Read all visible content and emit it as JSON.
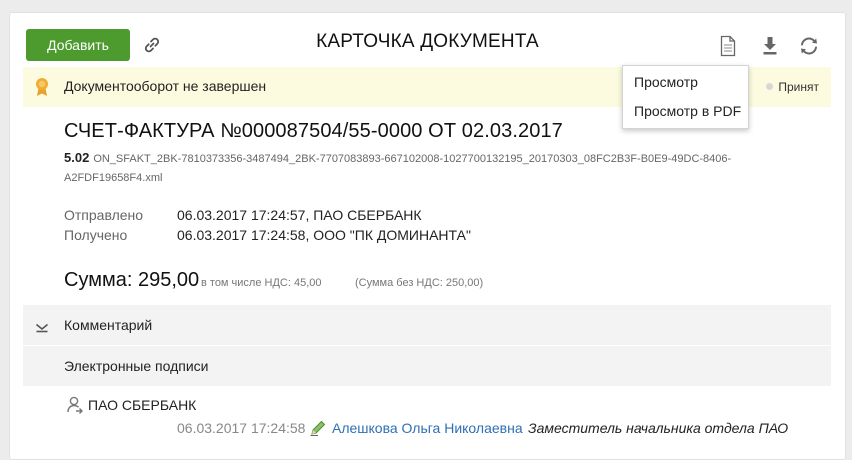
{
  "header": {
    "add_label": "Добавить",
    "title": "КАРТОЧКА ДОКУМЕНТА",
    "icons": [
      "link-icon",
      "document-icon",
      "download-icon",
      "refresh-icon"
    ]
  },
  "status": {
    "text": "Документооборот не завершен",
    "badge": "Принят"
  },
  "dropdown": {
    "items": [
      "Просмотр",
      "Просмотр в PDF"
    ]
  },
  "document": {
    "title": "СЧЕТ-ФАКТУРА №000087504/55-0000 ОТ 02.03.2017",
    "version": "5.02",
    "file": "ON_SFAKT_2BK-7810373356-3487494_2BK-7707083893-667102008-1027700132195_20170303_08FC2B3F-B0E9-49DC-8406-A2FDF19658F4.xml"
  },
  "meta": {
    "sent_label": "Отправлено",
    "sent_value": "06.03.2017 17:24:57, ПАО СБЕРБАНК",
    "received_label": "Получено",
    "received_value": "06.03.2017 17:24:58, ООО \"ПК ДОМИНАНТА\""
  },
  "sum": {
    "label": "Сумма: 295,00",
    "vat": "в том числе НДС: 45,00",
    "without_vat": "(Сумма без НДС: 250,00)"
  },
  "sections": {
    "comments": "Комментарий",
    "signatures": "Электронные подписи"
  },
  "signature": {
    "org": "ПАО СБЕРБАНК",
    "date": "06.03.2017 17:24:58",
    "person": "Алешкова Ольга Николаевна",
    "role": "Заместитель начальника отдела ПАО"
  },
  "colors": {
    "add_button": "#4d9a2f",
    "status_bg": "#fdfbdf",
    "link": "#2f6fb3",
    "section_bg": "#f3f3f3"
  }
}
